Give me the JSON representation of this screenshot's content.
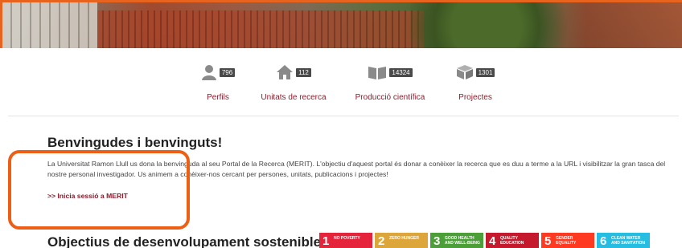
{
  "stats": [
    {
      "icon": "person-icon",
      "count": "796",
      "label": "Perfils"
    },
    {
      "icon": "house-icon",
      "count": "112",
      "label": "Unitats de recerca"
    },
    {
      "icon": "book-icon",
      "count": "14324",
      "label": "Producció científica"
    },
    {
      "icon": "cube-icon",
      "count": "1301",
      "label": "Projectes"
    }
  ],
  "welcome": {
    "title": "Benvingudes i benvinguts!",
    "text": "La Universitat Ramon Llull us dona la benvinguda al seu Portal de la Recerca (MERIT). L'objectiu d'aquest portal és donar a conèixer la recerca que es duu a terme a la URL i visibilitzar la gran tasca del nostre personal investigador. Us animem a conèixer-nos cercant per persones, unitats, publicacions i projectes!",
    "login_link": ">> Inicia sessió a MERIT"
  },
  "sdg": {
    "title": "Objectius de desenvolupament sostenible",
    "goals": [
      {
        "num": "1",
        "text": "NO POVERTY",
        "color": "#e5243b"
      },
      {
        "num": "2",
        "text": "ZERO HUNGER",
        "color": "#dda63a"
      },
      {
        "num": "3",
        "text": "GOOD HEALTH AND WELL-BEING",
        "color": "#4c9f38"
      },
      {
        "num": "4",
        "text": "QUALITY EDUCATION",
        "color": "#c5192d"
      },
      {
        "num": "5",
        "text": "GENDER EQUALITY",
        "color": "#ff3a21"
      },
      {
        "num": "6",
        "text": "CLEAN WATER AND SANITATION",
        "color": "#26bde2"
      }
    ]
  },
  "colors": {
    "accent": "#8a1c2c",
    "highlight": "#ec5f14"
  }
}
